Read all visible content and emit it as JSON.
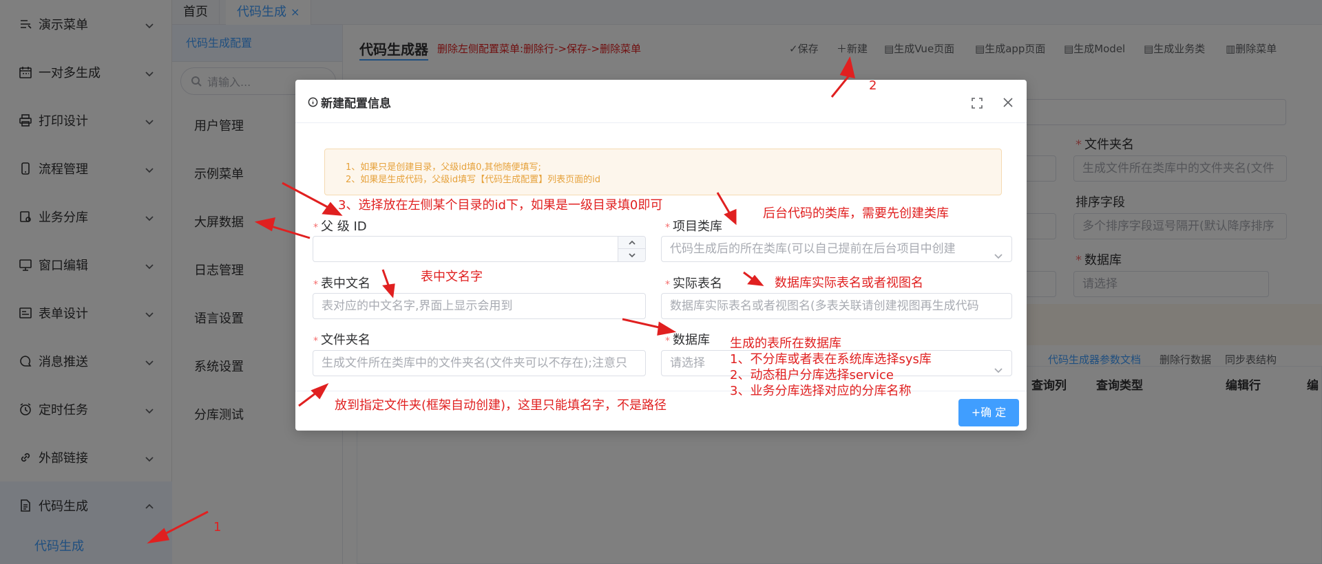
{
  "sidebar": {
    "items": [
      {
        "label": "演示菜单"
      },
      {
        "label": "一对多生成"
      },
      {
        "label": "打印设计"
      },
      {
        "label": "流程管理"
      },
      {
        "label": "业务分库"
      },
      {
        "label": "窗口编辑"
      },
      {
        "label": "表单设计"
      },
      {
        "label": "消息推送"
      },
      {
        "label": "定时任务"
      },
      {
        "label": "外部链接"
      },
      {
        "label": "代码生成"
      }
    ],
    "sub_item": "代码生成"
  },
  "tabs": {
    "home": "首页",
    "active": "代码生成",
    "close": "×"
  },
  "submenu": {
    "config_label": "代码生成配置",
    "search_placeholder": "请输入...",
    "items": [
      "用户管理",
      "示例菜单",
      "大屏数据",
      "日志管理",
      "语言设置",
      "系统设置",
      "分库测试"
    ]
  },
  "main": {
    "title": "代码生成器",
    "tip": "删除左侧配置菜单:删除行->保存->删除菜单",
    "toolbar": {
      "save": "✓保存",
      "new": "＋新建",
      "vue": "生成Vue页面",
      "app": "生成app页面",
      "model": "生成Model",
      "biz": "生成业务类",
      "del_menu": "删除菜单"
    },
    "bg_labels": {
      "folder": "文件夹名",
      "sort": "排序字段",
      "db": "数据库"
    },
    "bg_fields": {
      "folder": "生成文件所在类库中的文件夹名(文件",
      "sort": "多个排序字段逗号隔开(默认降序排序",
      "db": "请选择"
    },
    "links": {
      "doc": "代码生成器参数文档",
      "del_row": "删除行数据",
      "sync": "同步表结构"
    },
    "table_headers": [
      "查询列",
      "查询类型",
      "编辑行",
      "编"
    ]
  },
  "modal": {
    "title": "新建配置信息",
    "alert_lines": [
      "1、如果只是创建目录，父级id填0,其他随便填写;",
      "2、如果是生成代码，父级id填写【代码生成配置】列表页面的id"
    ],
    "required_mark": "*",
    "fields": {
      "parent_id": {
        "label": "父 级 ID",
        "value": ""
      },
      "project": {
        "label": "项目类库",
        "placeholder": "代码生成后的所在类库(可以自己提前在后台项目中创建"
      },
      "table_cn": {
        "label": "表中文名",
        "placeholder": "表对应的中文名字,界面上显示会用到"
      },
      "table_real": {
        "label": "实际表名",
        "placeholder": "数据库实际表名或者视图名(多表关联请创建视图再生成代码"
      },
      "folder": {
        "label": "文件夹名",
        "placeholder": "生成文件所在类库中的文件夹名(文件夹可以不存在);注意只"
      },
      "database": {
        "label": "数据库",
        "placeholder": "请选择"
      }
    },
    "ok_button": "+确 定"
  },
  "annotations": {
    "a1": "1",
    "a2": "2",
    "a3": "3、选择放在左侧某个目录的id下，如果是一级目录填0即可",
    "project": "后台代码的类库，需要先创建类库",
    "table_cn": "表中文名字",
    "table_real": "数据库实际表名或者视图名",
    "db_lines": [
      "生成的表所在数据库",
      "1、不分库或者表在系统库选择sys库",
      "2、动态租户分库选择service",
      "3、业务分库选择对应的分库名称"
    ],
    "folder": "放到指定文件夹(框架自动创建)，这里只能填名字，不是路径"
  },
  "colors": {
    "primary": "#409eff",
    "annotation": "#e02020",
    "warning": "#e6a23c",
    "required": "#f56c6c"
  }
}
